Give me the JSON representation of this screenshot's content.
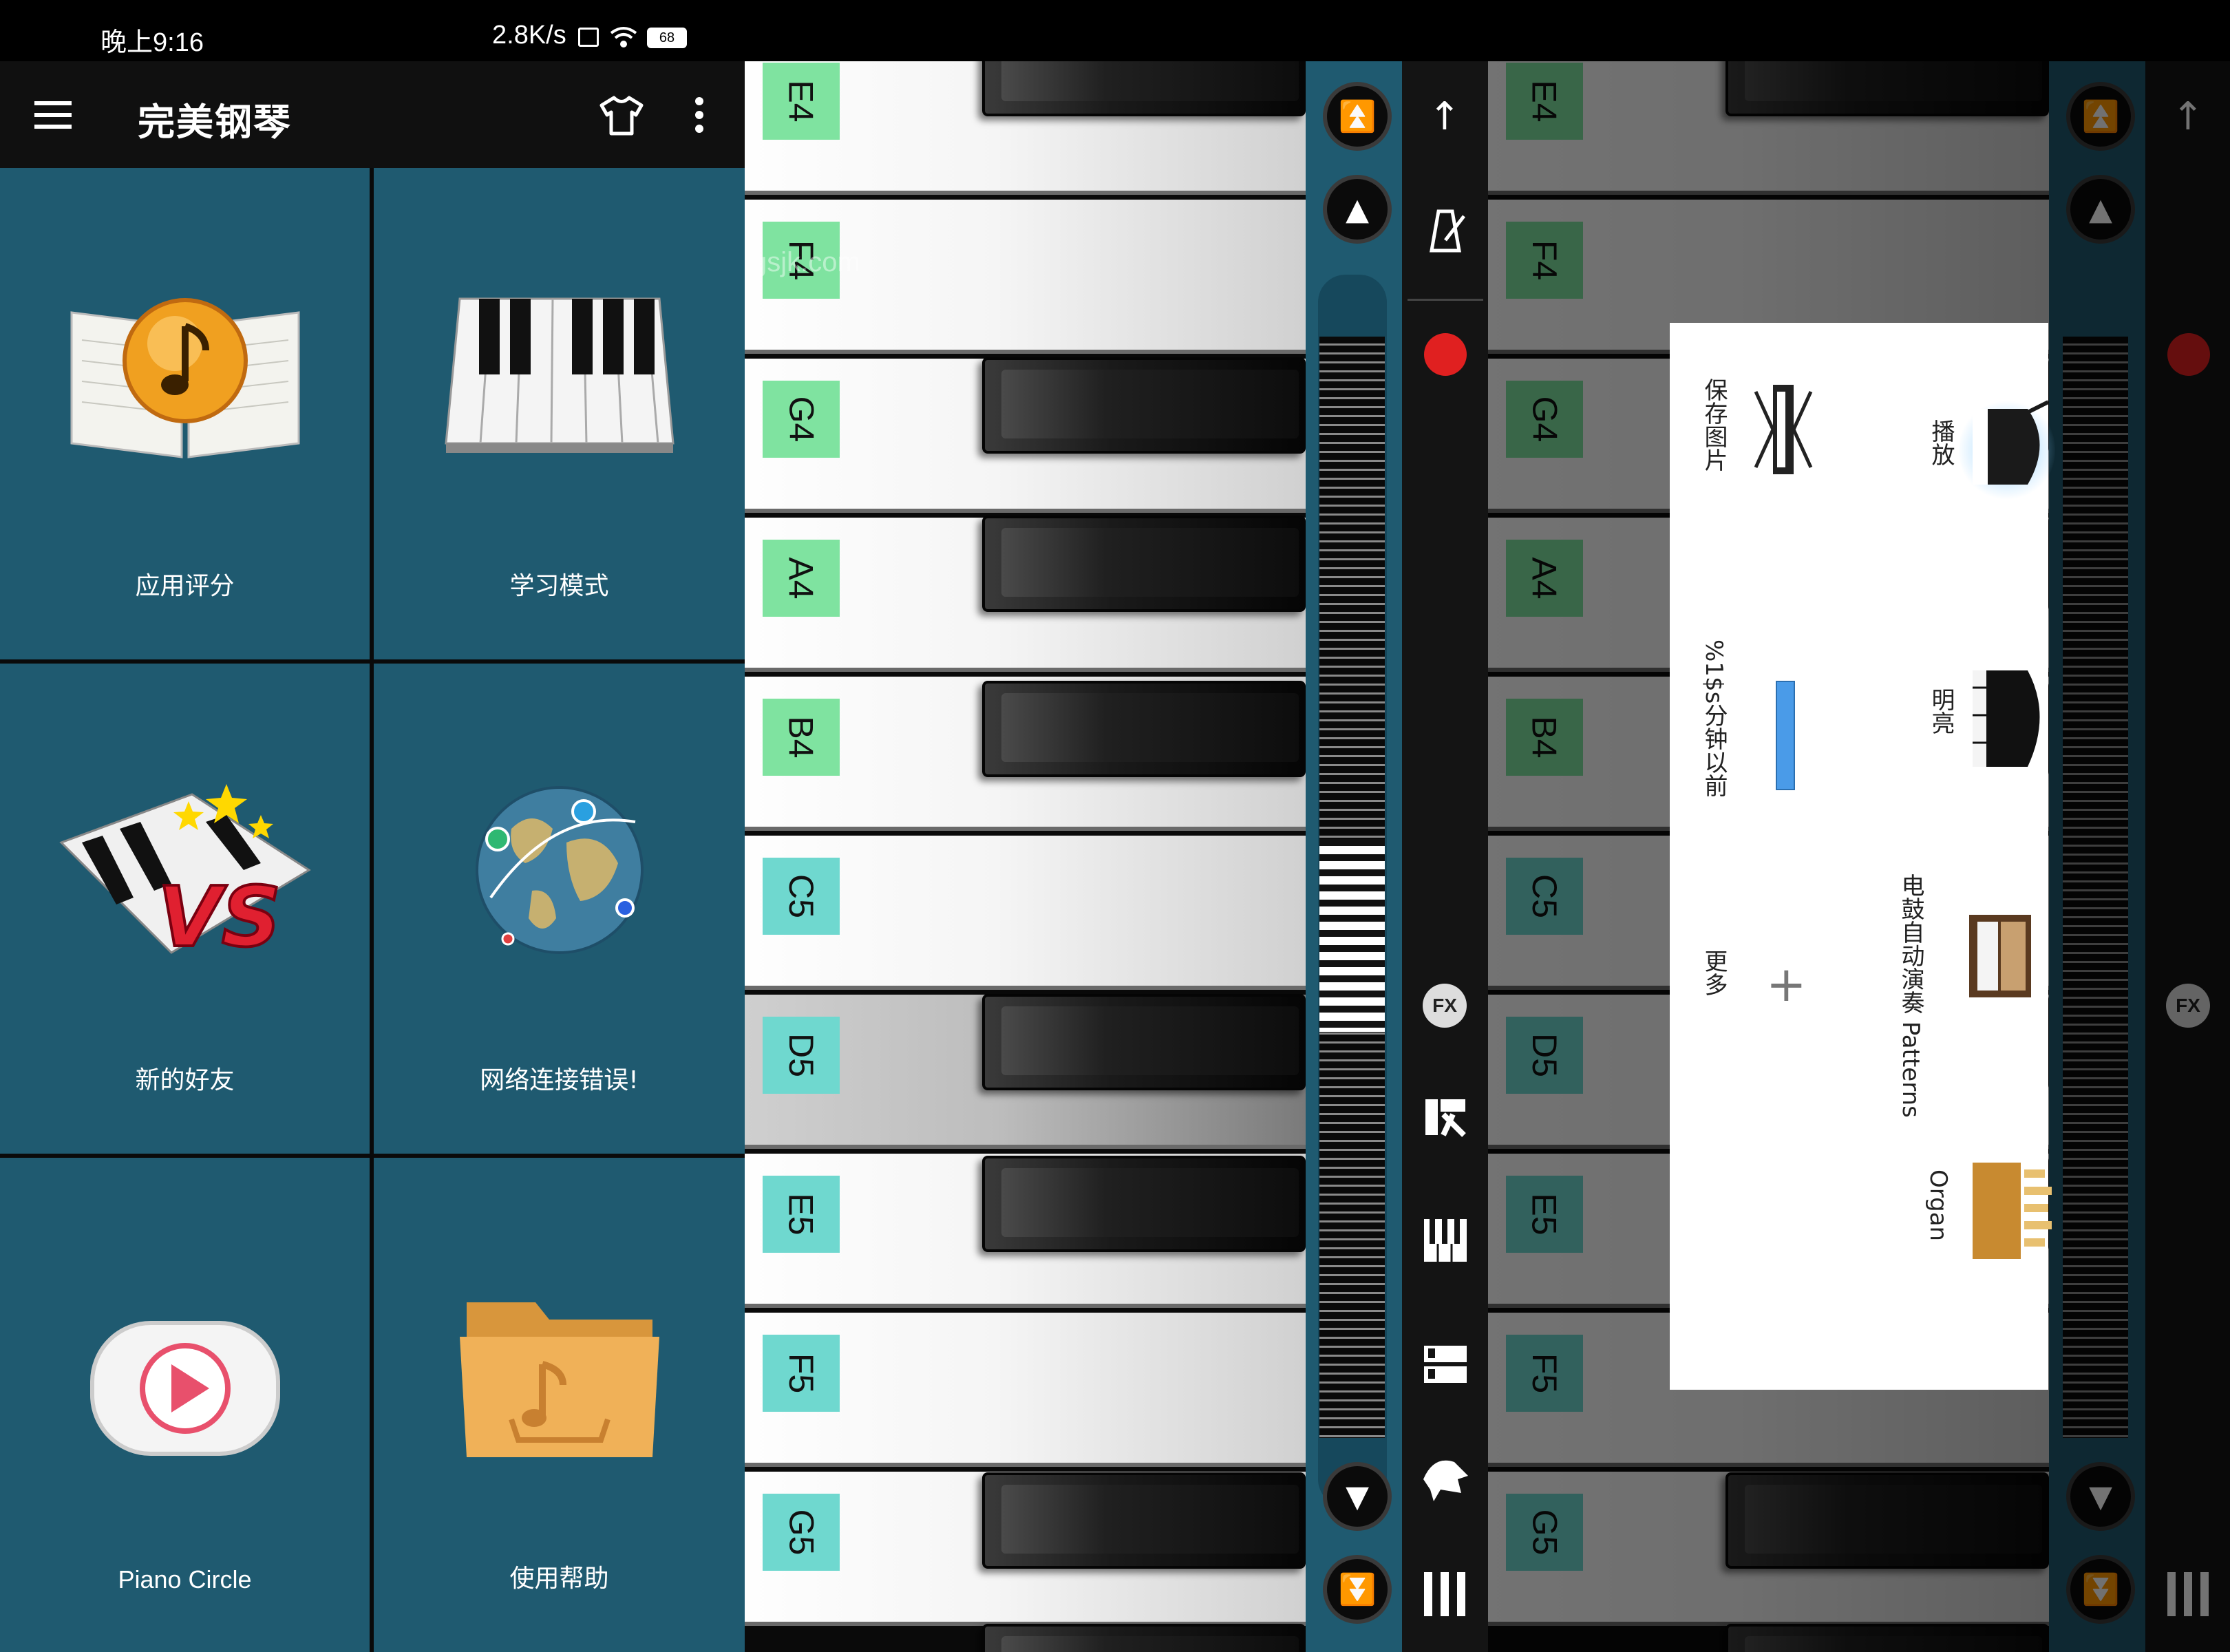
{
  "status_bar": {
    "time": "晚上9:16",
    "speed": "2.8K/s",
    "battery": "68"
  },
  "app_bar": {
    "title": "完美钢琴",
    "icons": [
      "menu-icon",
      "shirt-icon",
      "more-vert-icon"
    ]
  },
  "menu_tiles": [
    {
      "label": "应用评分",
      "icon": "music-book-icon"
    },
    {
      "label": "学习模式",
      "icon": "piano-keys-icon"
    },
    {
      "label": "新的好友",
      "icon": "vs-piano-icon"
    },
    {
      "label": "网络连接错误!",
      "icon": "globe-icon"
    },
    {
      "label": "Piano Circle",
      "icon": "play-button-icon"
    },
    {
      "label": "使用帮助",
      "icon": "folder-icon"
    }
  ],
  "keyboard": {
    "notes": [
      "E4",
      "F4",
      "G4",
      "A4",
      "B4",
      "C5",
      "D5",
      "E5",
      "F5",
      "G5"
    ],
    "pressed_note": "D5",
    "watermark": "gsjk.com"
  },
  "toolbar_icons": [
    "arrow-up-icon",
    "metronome-icon",
    "record-icon",
    "fx-icon",
    "chord-icon",
    "keyboard-layout-icon",
    "split-keys-icon",
    "instrument-icon",
    "menu-lines-icon"
  ],
  "instrument_popup": {
    "items": [
      {
        "label": "播放",
        "icon": "grand-piano-glow-icon"
      },
      {
        "label": "明亮",
        "icon": "grand-piano-icon"
      },
      {
        "label": "电鼓自动演奏 Patterns",
        "icon": "upright-piano-icon"
      },
      {
        "label": "Organ",
        "icon": "organ-icon"
      },
      {
        "label": "保存图片",
        "icon": "keyboard-stand-icon"
      },
      {
        "label": "%1$s分钟以前",
        "icon": "progress-bar-icon"
      },
      {
        "label": "更多",
        "icon": "plus-icon"
      }
    ]
  },
  "colors": {
    "tile_bg": "#1f5a70",
    "note_label_green": "#7fe3a0",
    "note_label_cyan": "#6fd8cf",
    "record_red": "#e02020",
    "progress_blue": "#4a9be8"
  }
}
